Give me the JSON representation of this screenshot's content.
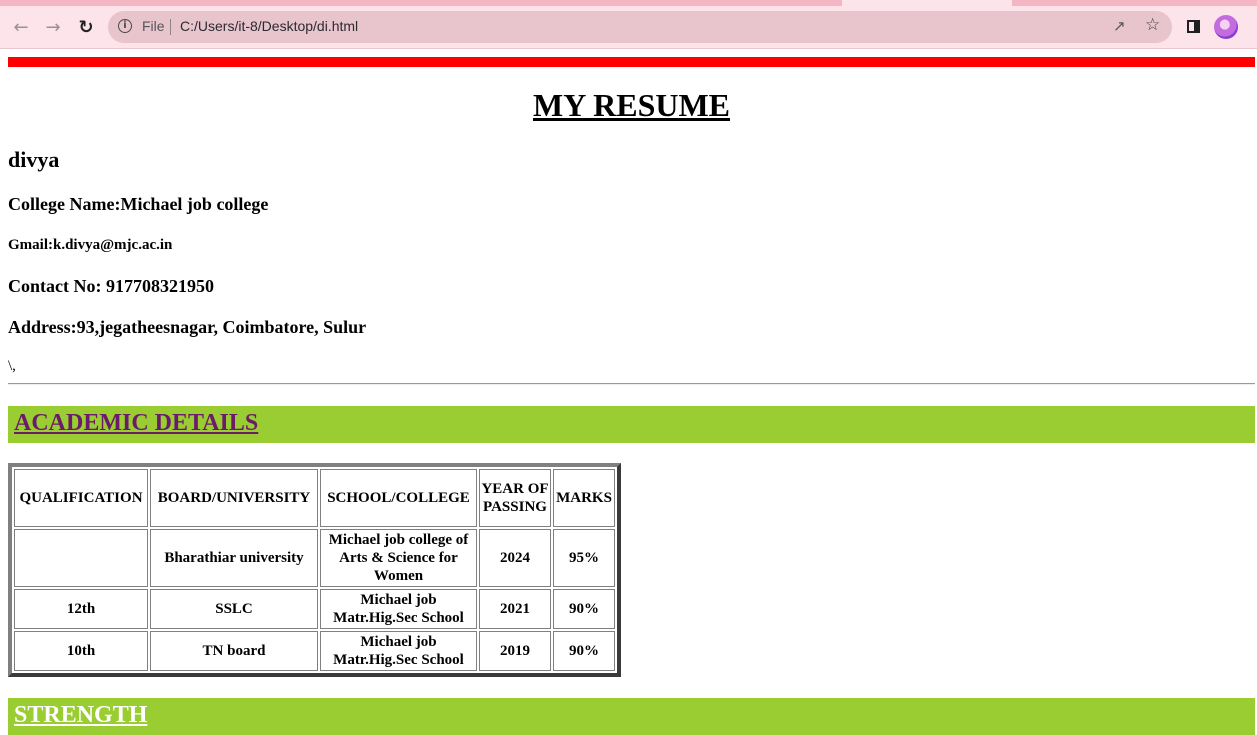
{
  "browser": {
    "scheme_label": "File",
    "url": "C:/Users/it-8/Desktop/di.html",
    "icons": [
      "back-icon",
      "forward-icon",
      "reload-icon",
      "info-icon",
      "share-icon",
      "star-icon",
      "side-panel-icon",
      "avatar"
    ]
  },
  "resume": {
    "title": "MY RESUME",
    "name": "divya",
    "college": "College Name:Michael job college",
    "gmail": "Gmail:k.divya@mjc.ac.in",
    "contact": "Contact No: 917708321950",
    "address": "Address:93,jegatheesnagar, Coimbatore, Sulur",
    "stray_text": "\\,"
  },
  "sections": {
    "academic": "ACADEMIC DETAILS",
    "strength": "STRENGTH"
  },
  "colors": {
    "top_bar": "#ff0000",
    "section_bg": "#9acd32",
    "academic_link": "#6a1b6a",
    "strength_link": "#ffffff"
  },
  "academic_table": {
    "headers": [
      "QUALIFICATION",
      "BOARD/UNIVERSITY",
      "SCHOOL/COLLEGE",
      "YEAR OF PASSING",
      "MARKS"
    ],
    "rows": [
      [
        "",
        "Bharathiar university",
        "Michael job college of Arts & Science for Women",
        "2024",
        "95%"
      ],
      [
        "12th",
        "SSLC",
        "Michael job Matr.Hig.Sec School",
        "2021",
        "90%"
      ],
      [
        "10th",
        "TN board",
        "Michael job Matr.Hig.Sec School",
        "2019",
        "90%"
      ]
    ]
  }
}
